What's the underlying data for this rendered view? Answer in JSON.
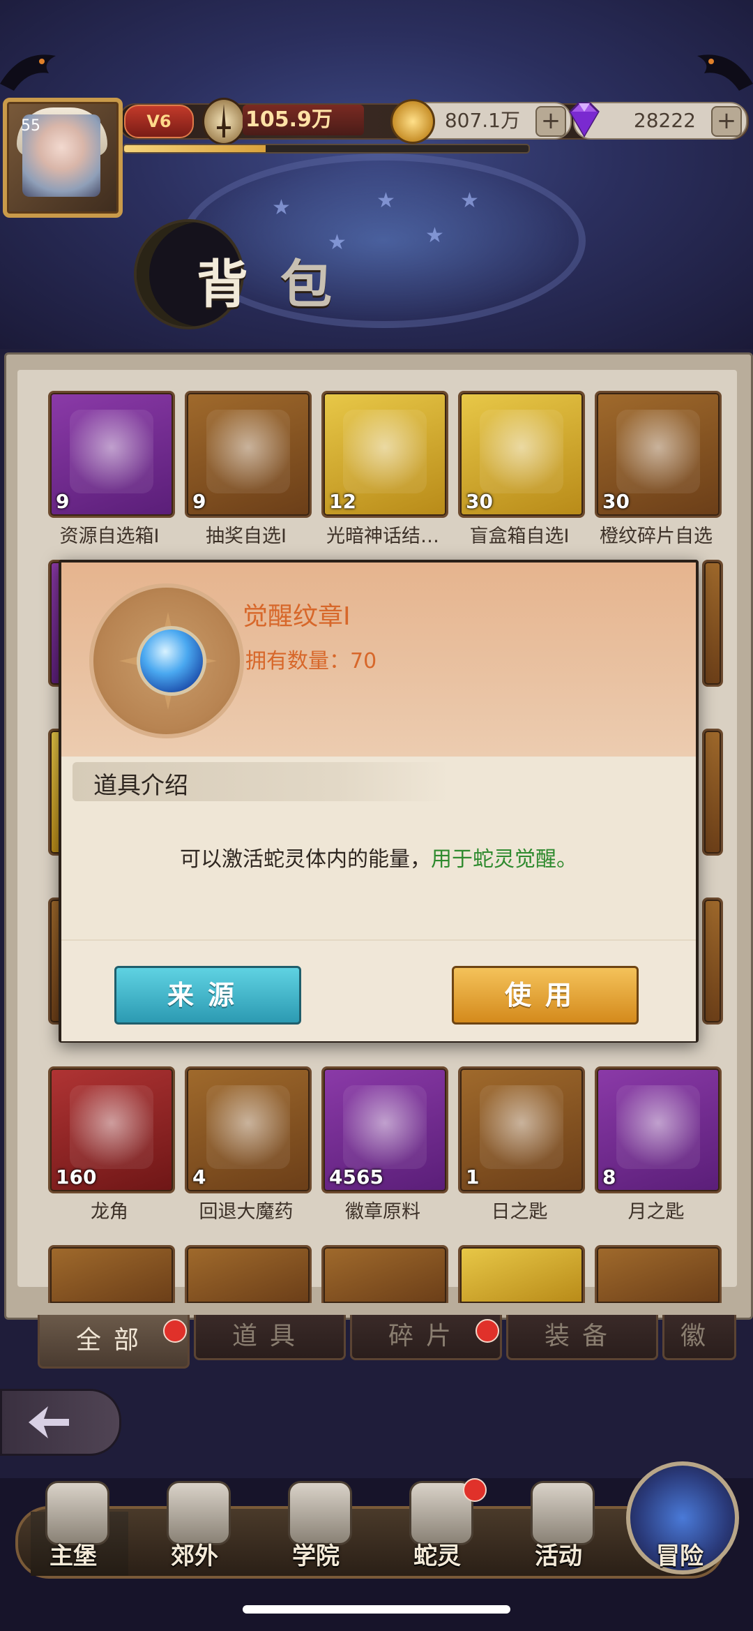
{
  "player": {
    "level": "55",
    "vip": "V6",
    "power": "105.9万",
    "exp_fraction": 0.35
  },
  "currencies": {
    "gold": "807.1万",
    "gems": "28222",
    "plus_label": "+"
  },
  "page_title": {
    "char1": "背",
    "char2": "包"
  },
  "items_row1": [
    {
      "name": "资源自选箱Ⅰ",
      "count": "9",
      "quality": "purple",
      "icon": "gift-box-icon"
    },
    {
      "name": "抽奖自选Ⅰ",
      "count": "9",
      "quality": "orange",
      "icon": "treasure-chest-icon"
    },
    {
      "name": "光暗神话结…",
      "count": "12",
      "quality": "gold",
      "icon": "mythic-gift-icon"
    },
    {
      "name": "盲盒箱自选Ⅰ",
      "count": "30",
      "quality": "gold",
      "icon": "blind-box-icon"
    },
    {
      "name": "橙纹碎片自选",
      "count": "30",
      "quality": "orange",
      "icon": "card-fragment-icon"
    }
  ],
  "items_row_lower": [
    {
      "name": "龙角",
      "count": "160",
      "quality": "red",
      "icon": "dragon-horn-icon"
    },
    {
      "name": "回退大魔药",
      "count": "4",
      "quality": "orange",
      "icon": "potion-icon"
    },
    {
      "name": "徽章原料",
      "count": "4565",
      "quality": "purple",
      "icon": "crystal-ore-icon"
    },
    {
      "name": "日之匙",
      "count": "1",
      "quality": "orange",
      "icon": "sun-key-icon"
    },
    {
      "name": "月之匙",
      "count": "8",
      "quality": "purple",
      "icon": "moon-key-icon"
    }
  ],
  "modal": {
    "item_name": "觉醒纹章Ⅰ",
    "quantity_label": "拥有数量：70",
    "section_title": "道具介绍",
    "description_plain": "可以激活蛇灵体内的能量，",
    "description_highlight": "用于蛇灵觉醒。",
    "source_button": "来源",
    "use_button": "使用"
  },
  "tabs": [
    {
      "label": "全部",
      "active": true,
      "badge": true
    },
    {
      "label": "道具",
      "active": false,
      "badge": false
    },
    {
      "label": "碎片",
      "active": false,
      "badge": true
    },
    {
      "label": "装备",
      "active": false,
      "badge": false
    },
    {
      "label": "徽",
      "active": false,
      "badge": false
    }
  ],
  "bottom_nav": [
    {
      "label": "主堡",
      "active": true,
      "icon": "castle-icon"
    },
    {
      "label": "郊外",
      "active": false,
      "icon": "crossed-swords-icon"
    },
    {
      "label": "学院",
      "active": false,
      "icon": "academy-icon"
    },
    {
      "label": "蛇灵",
      "active": false,
      "icon": "spirit-icon",
      "badge": true
    },
    {
      "label": "活动",
      "active": false,
      "icon": "gift-icon"
    },
    {
      "label": "冒险",
      "active": false,
      "icon": "adventure-icon"
    }
  ],
  "colors": {
    "accent_orange": "#d7672a",
    "highlight_green": "#2e8a2e",
    "source_button": "#3fb4c8",
    "use_button": "#e4a63a"
  }
}
